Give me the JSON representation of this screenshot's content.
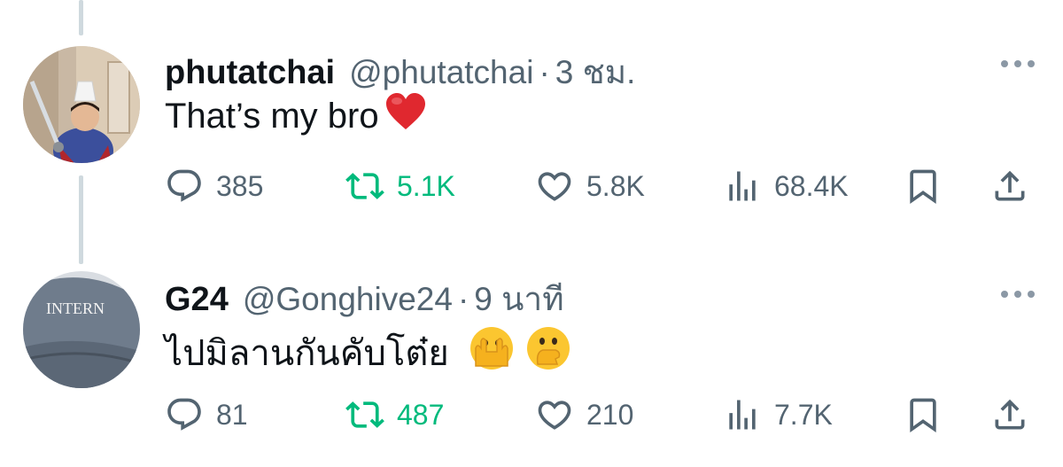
{
  "tweets": [
    {
      "display_name": "phutatchai",
      "handle": "@phutatchai",
      "separator": "·",
      "time": "3 ชม.",
      "text": "That’s my bro",
      "text_emojis": [
        "red-heart"
      ],
      "avatar": "boy-with-paper-hat",
      "stats": {
        "replies": "385",
        "reposts": "5.1K",
        "likes": "5.8K",
        "views": "68.4K"
      }
    },
    {
      "display_name": "G24",
      "handle": "@Gonghive24",
      "separator": "·",
      "time": "9 นาที",
      "text": "ไปมิลานกันคับโต๋ย",
      "text_emojis": [
        "face-with-open-eyes-and-hand-over-mouth",
        "face-with-hand-over-mouth"
      ],
      "avatar": "grey-cap",
      "avatar_text": "INTERN",
      "stats": {
        "replies": "81",
        "reposts": "487",
        "likes": "210",
        "views": "7.7K"
      }
    }
  ],
  "colors": {
    "text_primary": "#0f1419",
    "text_secondary": "#536471",
    "repost_active": "#00ba7c",
    "thread_line": "#cfd9de"
  },
  "icons": [
    "reply-icon",
    "repost-icon",
    "like-icon",
    "views-icon",
    "bookmark-icon",
    "share-icon",
    "more-icon"
  ]
}
